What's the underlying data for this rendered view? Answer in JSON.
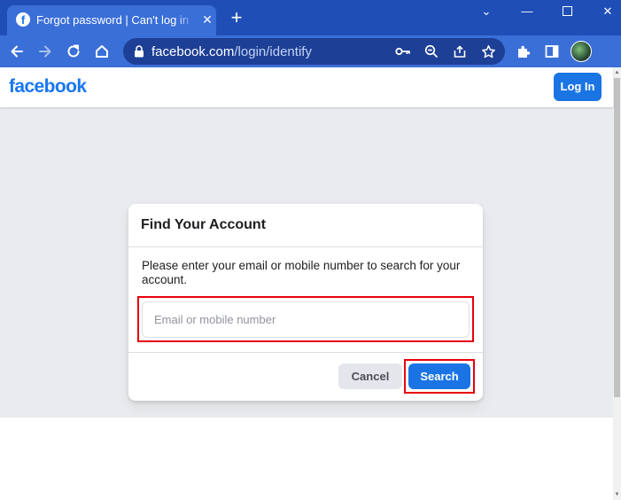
{
  "browser": {
    "tab": {
      "favicon": "f",
      "title": "Forgot password | Can't log in | F",
      "close": "✕"
    },
    "new_tab": "+",
    "window": {
      "dropdown": "⌄",
      "minimize": "—",
      "close": "✕"
    },
    "url": {
      "host": "facebook.com",
      "path": "/login/identify"
    },
    "icons": [
      "back-icon",
      "forward-icon",
      "reload-icon",
      "home-icon",
      "lock-icon",
      "key-icon",
      "zoom-icon",
      "share-icon",
      "star-icon",
      "extensions-icon",
      "side-panel-icon",
      "profile-avatar"
    ],
    "colors": {
      "titlebar": "#1f4fb6",
      "toolbar": "#3a6fd8"
    }
  },
  "header": {
    "logo": "facebook",
    "login_label": "Log In"
  },
  "card": {
    "title": "Find Your Account",
    "description": "Please enter your email or mobile number to search for your account.",
    "input_placeholder": "Email or mobile number",
    "input_value": "",
    "cancel_label": "Cancel",
    "search_label": "Search"
  },
  "colors": {
    "brand": "#1877f2",
    "button_blue": "#1b74e4",
    "highlight": "#e8000b",
    "page_background": "#e9ebee"
  }
}
